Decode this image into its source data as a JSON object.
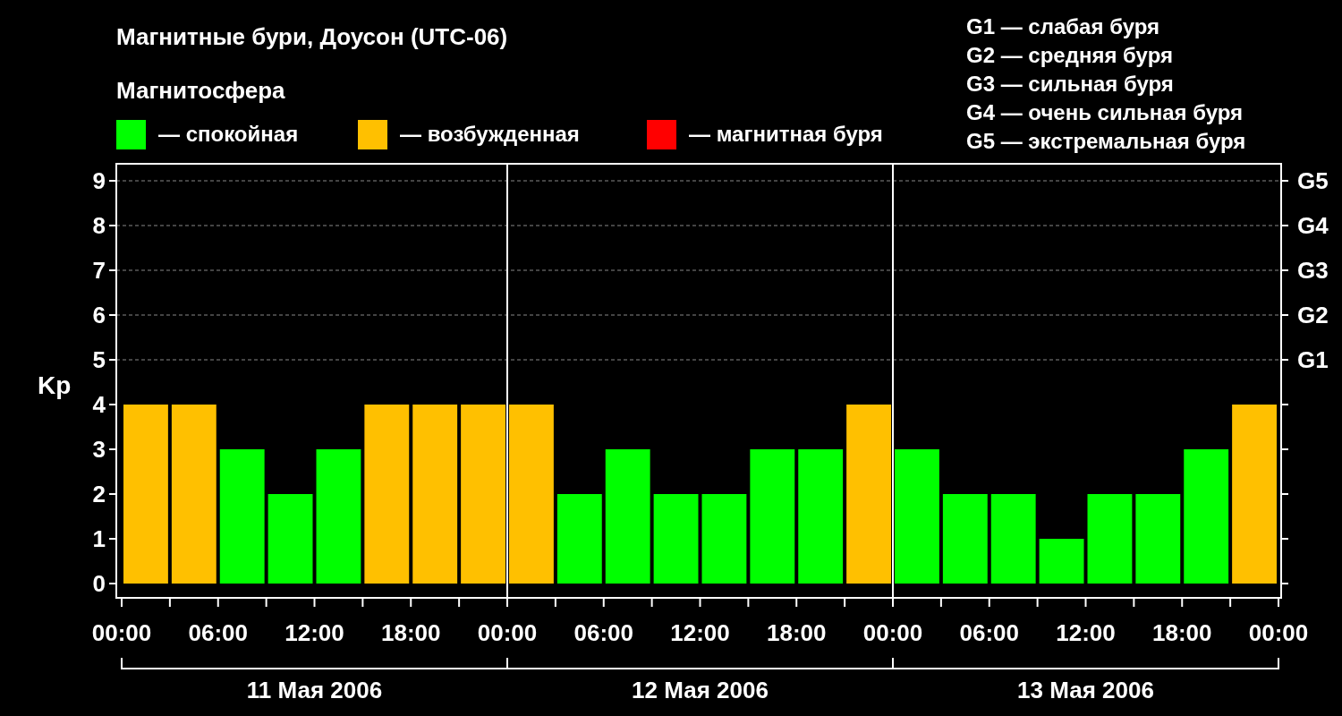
{
  "title": "Магнитные бури, Доусон (UTC-06)",
  "legend": {
    "title": "Магнитосфера",
    "items": [
      {
        "label": "— спокойная",
        "color": "#00ff00"
      },
      {
        "label": "— возбужденная",
        "color": "#ffc000"
      },
      {
        "label": "— магнитная буря",
        "color": "#ff0000"
      }
    ]
  },
  "storm_scale": [
    "G1 — слабая буря",
    "G2 — средняя буря",
    "G3 — сильная буря",
    "G4 — очень сильная буря",
    "G5 — экстремальная буря"
  ],
  "chart_data": {
    "type": "bar",
    "ylabel": "Kp",
    "stacked": true,
    "grid": true,
    "series": [
      {
        "color": "#00ff00",
        "values": [
          null,
          null,
          3,
          2,
          3,
          null,
          null,
          null,
          null,
          2,
          3,
          2,
          2,
          3,
          3,
          null,
          3,
          2,
          2,
          1,
          2,
          2,
          3,
          null
        ]
      },
      {
        "color": "#ffc000",
        "values": [
          4,
          4,
          null,
          null,
          null,
          4,
          4,
          4,
          4,
          null,
          null,
          null,
          null,
          null,
          null,
          4,
          null,
          null,
          null,
          null,
          null,
          null,
          null,
          4
        ]
      }
    ],
    "ylim": [
      -0.32,
      9.38
    ],
    "yticks": [
      0,
      1,
      2,
      3,
      4,
      5,
      6,
      7,
      8,
      9
    ]
  },
  "storm_levels": [
    "G5",
    "G4",
    "G3",
    "G2",
    "G1"
  ],
  "time_labels": [
    "00:00",
    "06:00",
    "12:00",
    "18:00",
    "00:00",
    "06:00",
    "12:00",
    "18:00",
    "00:00",
    "06:00",
    "12:00",
    "18:00",
    "00:00"
  ],
  "days": [
    "11 Мая 2006",
    "12 Мая 2006",
    "13 Мая 2006"
  ]
}
